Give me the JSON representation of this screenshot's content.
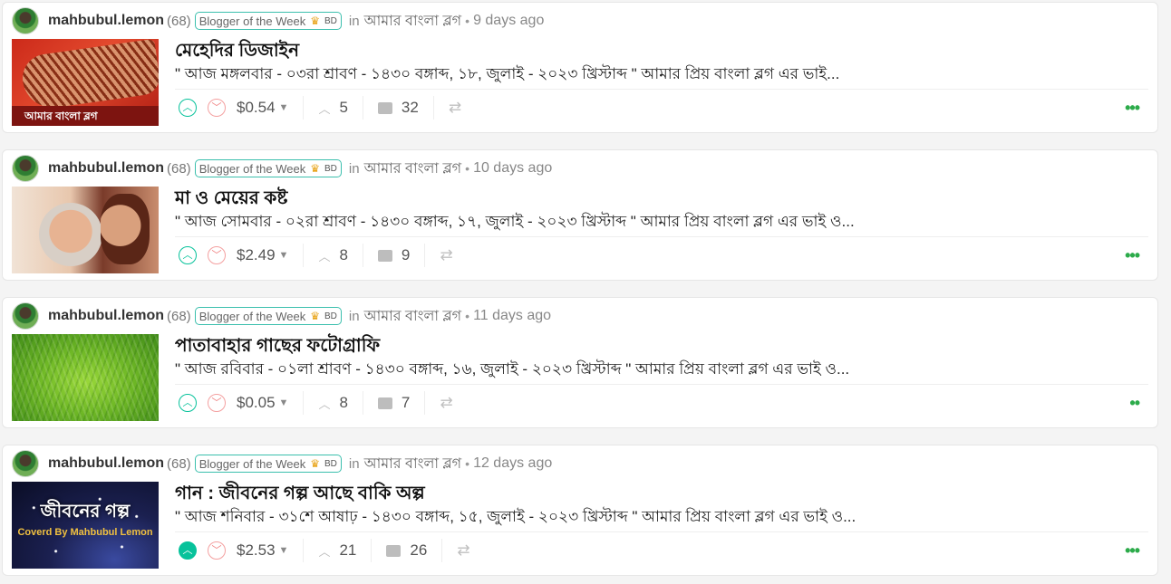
{
  "posts": [
    {
      "author": "mahbubul.lemon",
      "reputation": "(68)",
      "badge": "Blogger of the Week",
      "badge_suffix": "BD",
      "in_label": "in",
      "community": "আমার বাংলা ব্লগ",
      "age": "9 days ago",
      "title": "মেহেদির ডিজাইন",
      "excerpt": "\" আজ মঙ্গলবার - ০৩রা শ্রাবণ - ১৪৩০ বঙ্গাব্দ, ১৮, জুলাই - ২০২৩ খ্রিস্টাব্দ \" আমার প্রিয় বাংলা ব্লগ এর ভাই...",
      "payout": "$0.54",
      "votes": "5",
      "comments": "32",
      "upvoted": false
    },
    {
      "author": "mahbubul.lemon",
      "reputation": "(68)",
      "badge": "Blogger of the Week",
      "badge_suffix": "BD",
      "in_label": "in",
      "community": "আমার বাংলা ব্লগ",
      "age": "10 days ago",
      "title": "মা ও মেয়ের কষ্ট",
      "excerpt": "\" আজ সোমবার - ০২রা শ্রাবণ - ১৪৩০ বঙ্গাব্দ, ১৭, জুলাই - ২০২৩ খ্রিস্টাব্দ \" আমার প্রিয় বাংলা ব্লগ এর ভাই ও...",
      "payout": "$2.49",
      "votes": "8",
      "comments": "9",
      "upvoted": false
    },
    {
      "author": "mahbubul.lemon",
      "reputation": "(68)",
      "badge": "Blogger of the Week",
      "badge_suffix": "BD",
      "in_label": "in",
      "community": "আমার বাংলা ব্লগ",
      "age": "11 days ago",
      "title": "পাতাবাহার গাছের ফটোগ্রাফি",
      "excerpt": "\" আজ রবিবার - ০১লা শ্রাবণ - ১৪৩০ বঙ্গাব্দ, ১৬, জুলাই - ২০২৩ খ্রিস্টাব্দ \" আমার প্রিয় বাংলা ব্লগ এর ভাই ও...",
      "payout": "$0.05",
      "votes": "8",
      "comments": "7",
      "upvoted": false
    },
    {
      "author": "mahbubul.lemon",
      "reputation": "(68)",
      "badge": "Blogger of the Week",
      "badge_suffix": "BD",
      "in_label": "in",
      "community": "আমার বাংলা ব্লগ",
      "age": "12 days ago",
      "title": "গান : জীবনের গল্প আছে বাকি অল্প",
      "excerpt": "\" আজ শনিবার - ৩১শে আষাঢ় - ১৪৩০ বঙ্গাব্দ, ১৫, জুলাই - ২০২৩ খ্রিস্টাব্দ \" আমার প্রিয় বাংলা ব্লগ এর ভাই ও...",
      "payout": "$2.53",
      "votes": "21",
      "comments": "26",
      "upvoted": true
    }
  ],
  "thumbnails": {
    "post0_caption": "আমার বাংলা ব্লগ",
    "post3_title": "জীবনের গল্প",
    "post3_subtitle": "Coverd By Mahbubul Lemon"
  },
  "icons": {
    "upvote": "chevron-up-circle",
    "downvote": "chevron-down-circle",
    "payout_menu": "caret-down",
    "votes": "chevron-up",
    "comments": "comments",
    "reblog": "reblog",
    "more": "ellipsis"
  },
  "colors": {
    "upvote": "#07c29b",
    "downvote": "#f08080",
    "badge_border": "#3bbfad",
    "more": "#2cab4a"
  }
}
